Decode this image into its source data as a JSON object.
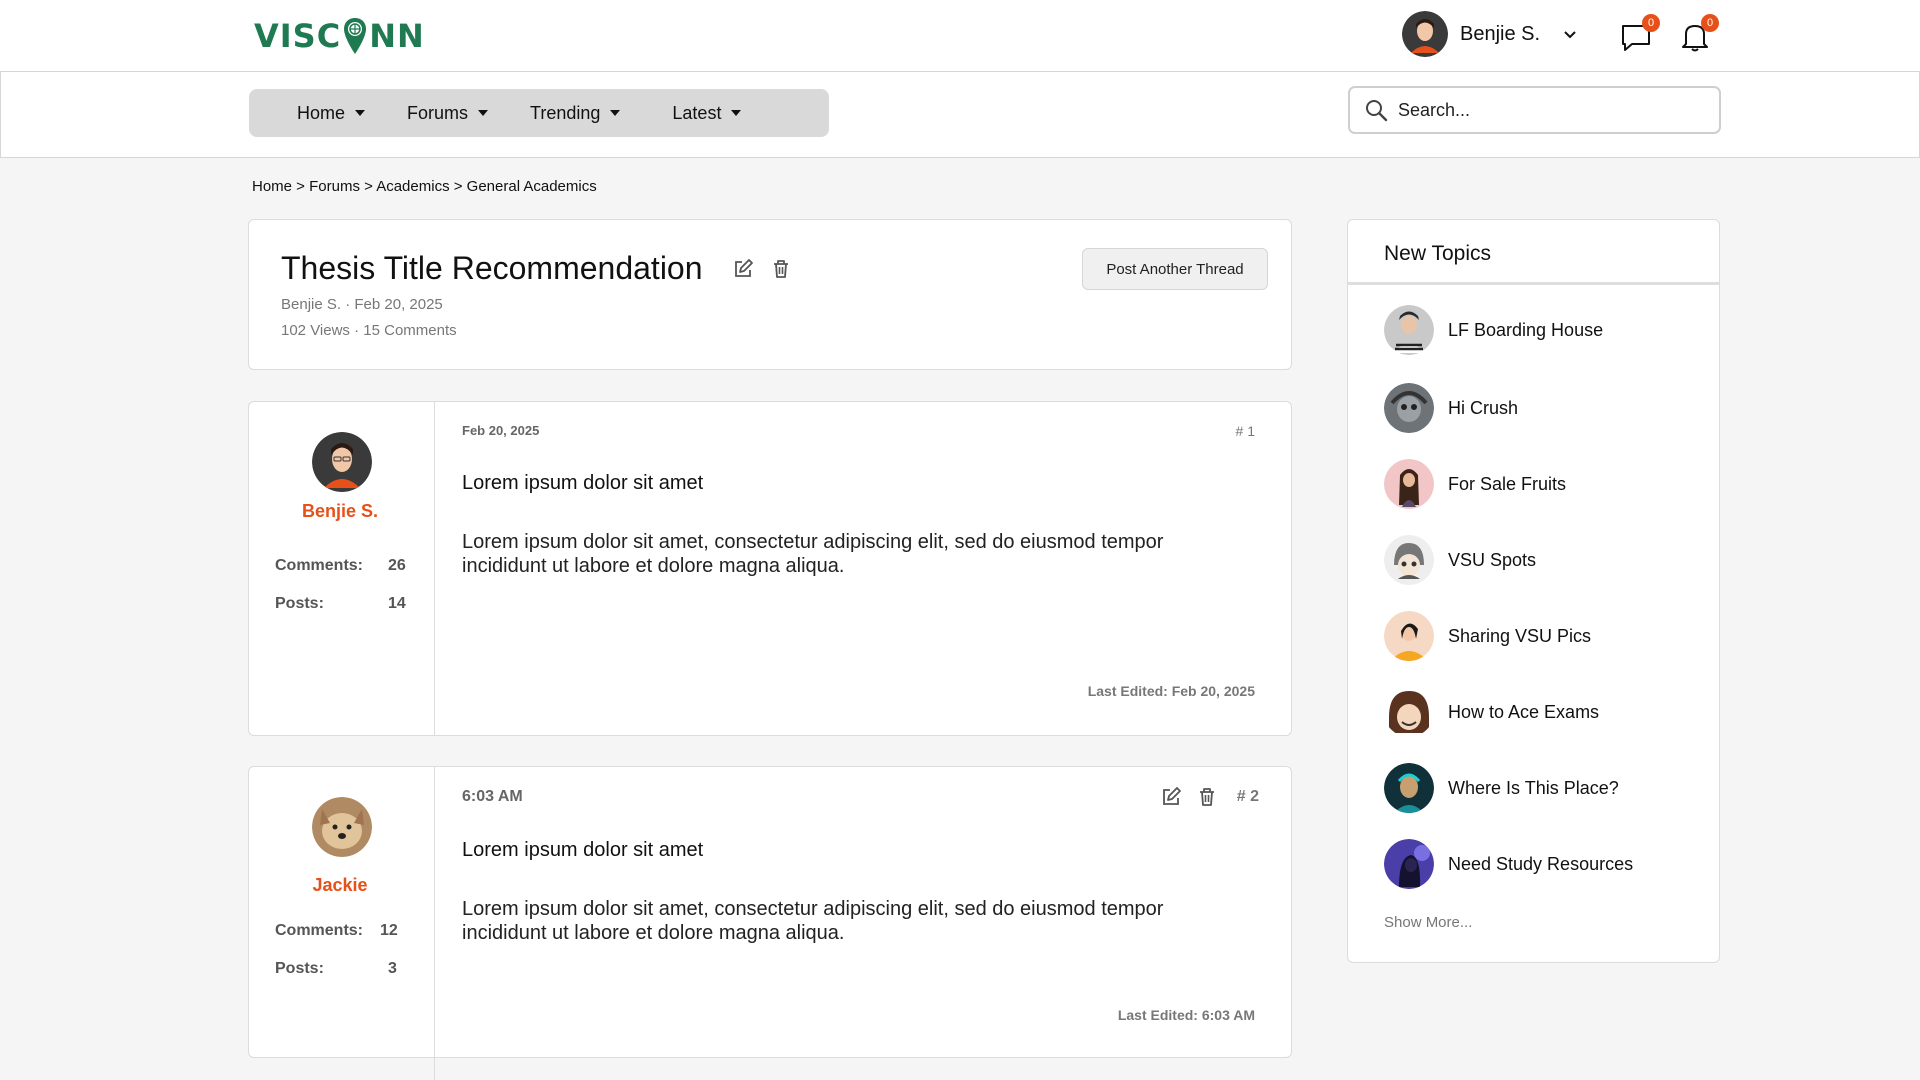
{
  "header": {
    "logo_prefix": "VISC",
    "logo_suffix": "NN",
    "user_name": "Benjie S.",
    "messages_count": "0",
    "notifications_count": "0"
  },
  "nav": {
    "items": [
      {
        "label": "Home"
      },
      {
        "label": "Forums"
      },
      {
        "label": "Trending"
      },
      {
        "label": "Latest"
      }
    ],
    "search_placeholder": "Search..."
  },
  "breadcrumb": "Home > Forums > Academics > General Academics",
  "thread": {
    "title": "Thesis Title Recommendation",
    "author_date": "Benjie S. · Feb 20, 2025",
    "stats": "102 Views · 15 Comments",
    "post_button": "Post Another Thread"
  },
  "posts": [
    {
      "time": "Feb 20, 2025",
      "number": "# 1",
      "author": "Benjie S.",
      "comments_label": "Comments:",
      "comments": "26",
      "posts_label": "Posts:",
      "posts": "14",
      "subject": "Lorem ipsum dolor sit amet",
      "body": "Lorem ipsum dolor sit amet, consectetur adipiscing elit, sed do eiusmod tempor incididunt ut labore et dolore magna aliqua.",
      "last_edited": "Last Edited: Feb 20, 2025"
    },
    {
      "time": "6:03 AM",
      "number": "# 2",
      "author": "Jackie",
      "comments_label": "Comments:",
      "comments": "12",
      "posts_label": "Posts:",
      "posts": "3",
      "subject": "Lorem ipsum dolor sit amet",
      "body": "Lorem ipsum dolor sit amet, consectetur adipiscing elit, sed do eiusmod tempor incididunt ut labore et dolore magna aliqua.",
      "last_edited": "Last Edited: 6:03 AM"
    }
  ],
  "sidebar": {
    "title": "New Topics",
    "topics": [
      {
        "label": "LF Boarding House"
      },
      {
        "label": "Hi Crush"
      },
      {
        "label": "For Sale Fruits"
      },
      {
        "label": "VSU Spots"
      },
      {
        "label": "Sharing VSU Pics"
      },
      {
        "label": "How to Ace Exams"
      },
      {
        "label": "Where Is This Place?"
      },
      {
        "label": "Need Study Resources"
      }
    ],
    "show_more": "Show More..."
  },
  "colors": {
    "brand": "#1f7a52",
    "accent": "#e8501a",
    "nav_pill": "#d9d9d9"
  }
}
